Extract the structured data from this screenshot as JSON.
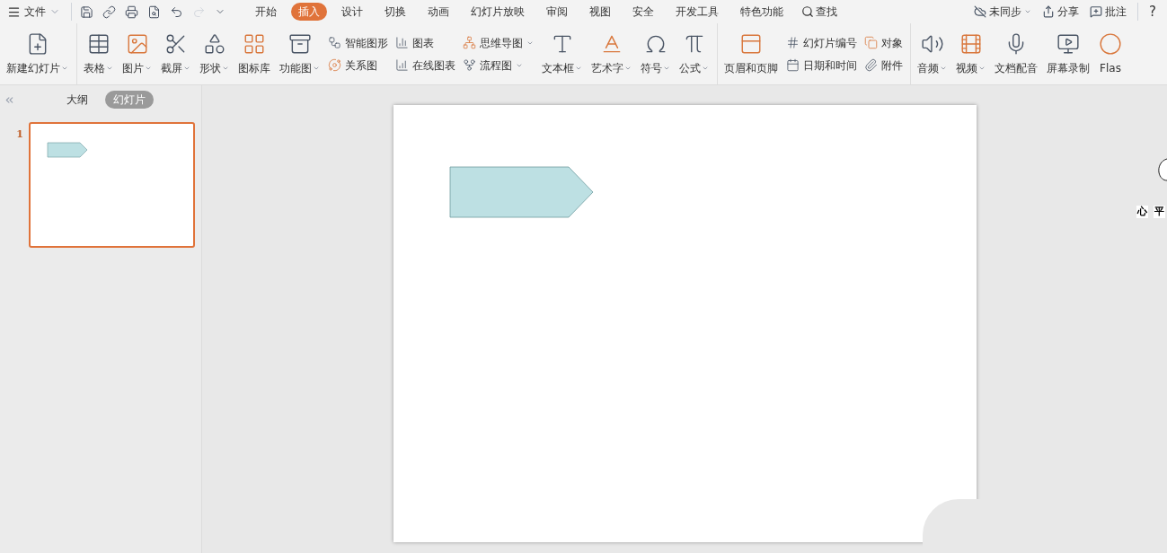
{
  "menu": {
    "label": "文件"
  },
  "quick_access": [
    {
      "disabled": false
    },
    {
      "disabled": false
    },
    {
      "disabled": false
    },
    {
      "disabled": false
    },
    {
      "disabled": false
    },
    {
      "disabled": true
    },
    {
      "disabled": false
    }
  ],
  "tabs": [
    {
      "label": "开始",
      "selected": false
    },
    {
      "label": "插入",
      "selected": true
    },
    {
      "label": "设计",
      "selected": false
    },
    {
      "label": "切换",
      "selected": false
    },
    {
      "label": "动画",
      "selected": false
    },
    {
      "label": "幻灯片放映",
      "selected": false
    },
    {
      "label": "审阅",
      "selected": false
    },
    {
      "label": "视图",
      "selected": false
    },
    {
      "label": "安全",
      "selected": false
    },
    {
      "label": "开发工具",
      "selected": false
    },
    {
      "label": "特色功能",
      "selected": false
    }
  ],
  "search": {
    "label": "查找"
  },
  "top_right": [
    {
      "label": "未同步",
      "dropdown": true
    },
    {
      "label": "分享",
      "dropdown": false
    },
    {
      "label": "批注",
      "dropdown": false
    }
  ],
  "help": "?",
  "ribbon": [
    {
      "items": [
        {
          "kind": "large",
          "label": "新建幻灯片",
          "dropdown": true
        }
      ]
    },
    {
      "items": [
        {
          "kind": "large",
          "label": "表格",
          "dropdown": true
        },
        {
          "kind": "large",
          "label": "图片",
          "dropdown": true
        },
        {
          "kind": "large",
          "label": "截屏",
          "dropdown": true
        },
        {
          "kind": "large",
          "label": "形状",
          "dropdown": true
        },
        {
          "kind": "large",
          "label": "图标库",
          "dropdown": false
        },
        {
          "kind": "large",
          "label": "功能图",
          "dropdown": true
        },
        {
          "kind": "stack",
          "items": [
            {
              "label": "智能图形",
              "dropdown": false
            },
            {
              "label": "关系图",
              "dropdown": false
            }
          ]
        },
        {
          "kind": "stack",
          "items": [
            {
              "label": "图表",
              "dropdown": false
            },
            {
              "label": "在线图表",
              "dropdown": false
            }
          ]
        },
        {
          "kind": "stack",
          "items": [
            {
              "label": "思维导图",
              "dropdown": true
            },
            {
              "label": "流程图",
              "dropdown": true
            }
          ]
        },
        {
          "kind": "large",
          "label": "文本框",
          "dropdown": true
        },
        {
          "kind": "large",
          "label": "艺术字",
          "dropdown": true
        },
        {
          "kind": "large",
          "label": "符号",
          "dropdown": true
        },
        {
          "kind": "large",
          "label": "公式",
          "dropdown": true
        }
      ]
    },
    {
      "items": [
        {
          "kind": "large",
          "label": "页眉和页脚",
          "dropdown": false
        },
        {
          "kind": "stack",
          "items": [
            {
              "label": "幻灯片编号",
              "dropdown": false
            },
            {
              "label": "日期和时间",
              "dropdown": false
            }
          ]
        },
        {
          "kind": "stack",
          "items": [
            {
              "label": "对象",
              "dropdown": false
            },
            {
              "label": "附件",
              "dropdown": false
            }
          ]
        }
      ]
    },
    {
      "items": [
        {
          "kind": "large",
          "label": "音频",
          "dropdown": true
        },
        {
          "kind": "large",
          "label": "视频",
          "dropdown": true
        },
        {
          "kind": "large",
          "label": "文档配音",
          "dropdown": false
        },
        {
          "kind": "large",
          "label": "屏幕录制",
          "dropdown": false
        },
        {
          "kind": "large",
          "label": "Flas",
          "dropdown": false
        }
      ]
    }
  ],
  "sidebar": {
    "tabs": [
      {
        "label": "大纲",
        "selected": false
      },
      {
        "label": "幻灯片",
        "selected": true
      }
    ],
    "slides": [
      {
        "number": "1",
        "selected": true
      }
    ]
  },
  "floating_widget": {
    "texts": [
      "心",
      "平"
    ]
  }
}
